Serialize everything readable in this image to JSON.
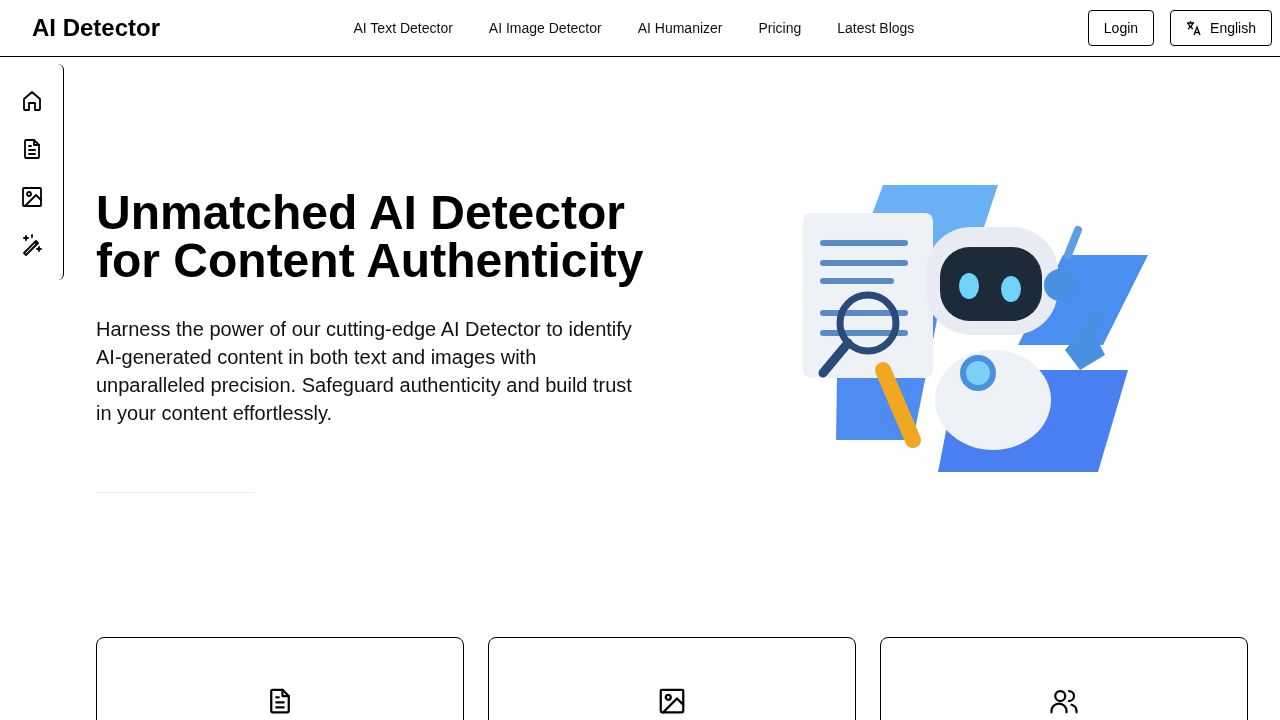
{
  "brand": "AI Detector",
  "nav_links": [
    "AI Text Detector",
    "AI Image Detector",
    "AI Humanizer",
    "Pricing",
    "Latest Blogs"
  ],
  "login_button": "Login",
  "language_button": "English",
  "sidebar": [
    {
      "kind": "home"
    },
    {
      "kind": "document"
    },
    {
      "kind": "image"
    },
    {
      "kind": "magic"
    }
  ],
  "hero": {
    "title_lines": [
      "Unmatched AI Detector",
      "for Content Authenticity"
    ],
    "description": "Harness the power of our cutting-edge AI Detector to identify AI-generated content in both text and images with unparalleled precision. Safeguard authenticity and build trust in your content effortlessly."
  },
  "feature_cards": [
    {
      "kind": "document"
    },
    {
      "kind": "image"
    },
    {
      "kind": "users"
    }
  ]
}
